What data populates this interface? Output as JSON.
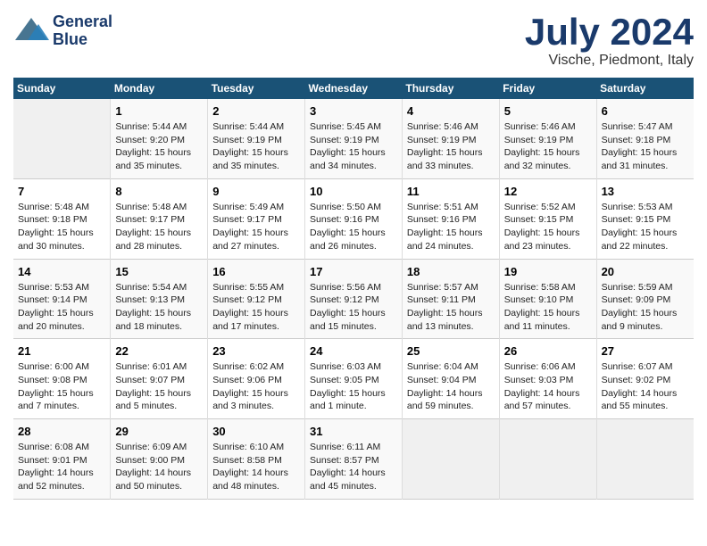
{
  "header": {
    "logo_line1": "General",
    "logo_line2": "Blue",
    "month_year": "July 2024",
    "location": "Vische, Piedmont, Italy"
  },
  "weekdays": [
    "Sunday",
    "Monday",
    "Tuesday",
    "Wednesday",
    "Thursday",
    "Friday",
    "Saturday"
  ],
  "weeks": [
    [
      {
        "day": null,
        "info": null
      },
      {
        "day": "1",
        "info": "Sunrise: 5:44 AM\nSunset: 9:20 PM\nDaylight: 15 hours\nand 35 minutes."
      },
      {
        "day": "2",
        "info": "Sunrise: 5:44 AM\nSunset: 9:19 PM\nDaylight: 15 hours\nand 35 minutes."
      },
      {
        "day": "3",
        "info": "Sunrise: 5:45 AM\nSunset: 9:19 PM\nDaylight: 15 hours\nand 34 minutes."
      },
      {
        "day": "4",
        "info": "Sunrise: 5:46 AM\nSunset: 9:19 PM\nDaylight: 15 hours\nand 33 minutes."
      },
      {
        "day": "5",
        "info": "Sunrise: 5:46 AM\nSunset: 9:19 PM\nDaylight: 15 hours\nand 32 minutes."
      },
      {
        "day": "6",
        "info": "Sunrise: 5:47 AM\nSunset: 9:18 PM\nDaylight: 15 hours\nand 31 minutes."
      }
    ],
    [
      {
        "day": "7",
        "info": "Sunrise: 5:48 AM\nSunset: 9:18 PM\nDaylight: 15 hours\nand 30 minutes."
      },
      {
        "day": "8",
        "info": "Sunrise: 5:48 AM\nSunset: 9:17 PM\nDaylight: 15 hours\nand 28 minutes."
      },
      {
        "day": "9",
        "info": "Sunrise: 5:49 AM\nSunset: 9:17 PM\nDaylight: 15 hours\nand 27 minutes."
      },
      {
        "day": "10",
        "info": "Sunrise: 5:50 AM\nSunset: 9:16 PM\nDaylight: 15 hours\nand 26 minutes."
      },
      {
        "day": "11",
        "info": "Sunrise: 5:51 AM\nSunset: 9:16 PM\nDaylight: 15 hours\nand 24 minutes."
      },
      {
        "day": "12",
        "info": "Sunrise: 5:52 AM\nSunset: 9:15 PM\nDaylight: 15 hours\nand 23 minutes."
      },
      {
        "day": "13",
        "info": "Sunrise: 5:53 AM\nSunset: 9:15 PM\nDaylight: 15 hours\nand 22 minutes."
      }
    ],
    [
      {
        "day": "14",
        "info": "Sunrise: 5:53 AM\nSunset: 9:14 PM\nDaylight: 15 hours\nand 20 minutes."
      },
      {
        "day": "15",
        "info": "Sunrise: 5:54 AM\nSunset: 9:13 PM\nDaylight: 15 hours\nand 18 minutes."
      },
      {
        "day": "16",
        "info": "Sunrise: 5:55 AM\nSunset: 9:12 PM\nDaylight: 15 hours\nand 17 minutes."
      },
      {
        "day": "17",
        "info": "Sunrise: 5:56 AM\nSunset: 9:12 PM\nDaylight: 15 hours\nand 15 minutes."
      },
      {
        "day": "18",
        "info": "Sunrise: 5:57 AM\nSunset: 9:11 PM\nDaylight: 15 hours\nand 13 minutes."
      },
      {
        "day": "19",
        "info": "Sunrise: 5:58 AM\nSunset: 9:10 PM\nDaylight: 15 hours\nand 11 minutes."
      },
      {
        "day": "20",
        "info": "Sunrise: 5:59 AM\nSunset: 9:09 PM\nDaylight: 15 hours\nand 9 minutes."
      }
    ],
    [
      {
        "day": "21",
        "info": "Sunrise: 6:00 AM\nSunset: 9:08 PM\nDaylight: 15 hours\nand 7 minutes."
      },
      {
        "day": "22",
        "info": "Sunrise: 6:01 AM\nSunset: 9:07 PM\nDaylight: 15 hours\nand 5 minutes."
      },
      {
        "day": "23",
        "info": "Sunrise: 6:02 AM\nSunset: 9:06 PM\nDaylight: 15 hours\nand 3 minutes."
      },
      {
        "day": "24",
        "info": "Sunrise: 6:03 AM\nSunset: 9:05 PM\nDaylight: 15 hours\nand 1 minute."
      },
      {
        "day": "25",
        "info": "Sunrise: 6:04 AM\nSunset: 9:04 PM\nDaylight: 14 hours\nand 59 minutes."
      },
      {
        "day": "26",
        "info": "Sunrise: 6:06 AM\nSunset: 9:03 PM\nDaylight: 14 hours\nand 57 minutes."
      },
      {
        "day": "27",
        "info": "Sunrise: 6:07 AM\nSunset: 9:02 PM\nDaylight: 14 hours\nand 55 minutes."
      }
    ],
    [
      {
        "day": "28",
        "info": "Sunrise: 6:08 AM\nSunset: 9:01 PM\nDaylight: 14 hours\nand 52 minutes."
      },
      {
        "day": "29",
        "info": "Sunrise: 6:09 AM\nSunset: 9:00 PM\nDaylight: 14 hours\nand 50 minutes."
      },
      {
        "day": "30",
        "info": "Sunrise: 6:10 AM\nSunset: 8:58 PM\nDaylight: 14 hours\nand 48 minutes."
      },
      {
        "day": "31",
        "info": "Sunrise: 6:11 AM\nSunset: 8:57 PM\nDaylight: 14 hours\nand 45 minutes."
      },
      {
        "day": null,
        "info": null
      },
      {
        "day": null,
        "info": null
      },
      {
        "day": null,
        "info": null
      }
    ]
  ]
}
